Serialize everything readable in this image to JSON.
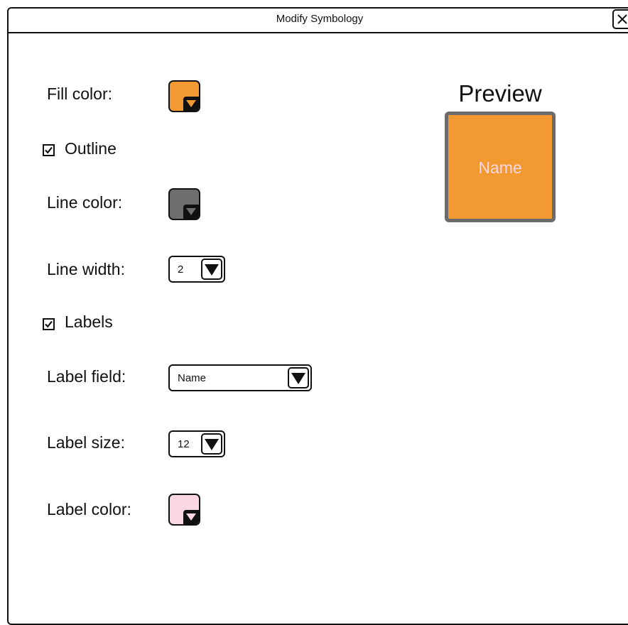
{
  "dialog": {
    "title": "Modify Symbology",
    "close_icon": "close-icon"
  },
  "form": {
    "fill_color": {
      "label": "Fill color:",
      "color": "#F29A31"
    },
    "outline": {
      "label": "Outline",
      "checked": true
    },
    "line_color": {
      "label": "Line color:",
      "color": "#6E6E6E"
    },
    "line_width": {
      "label": "Line width:",
      "value": "2"
    },
    "labels": {
      "label": "Labels",
      "checked": true
    },
    "label_field": {
      "label": "Label field:",
      "value": "Name"
    },
    "label_size": {
      "label": "Label size:",
      "value": "12"
    },
    "label_color": {
      "label": "Label color:",
      "color": "#FAD7E3"
    }
  },
  "preview": {
    "title": "Preview",
    "sample_text": "Name",
    "fill_color": "#F29A31",
    "outline_color": "#6B6B6B",
    "text_color": "#FAD7E3"
  },
  "icons": {
    "dropdown": "triangle-down-icon",
    "check": "check-icon"
  }
}
